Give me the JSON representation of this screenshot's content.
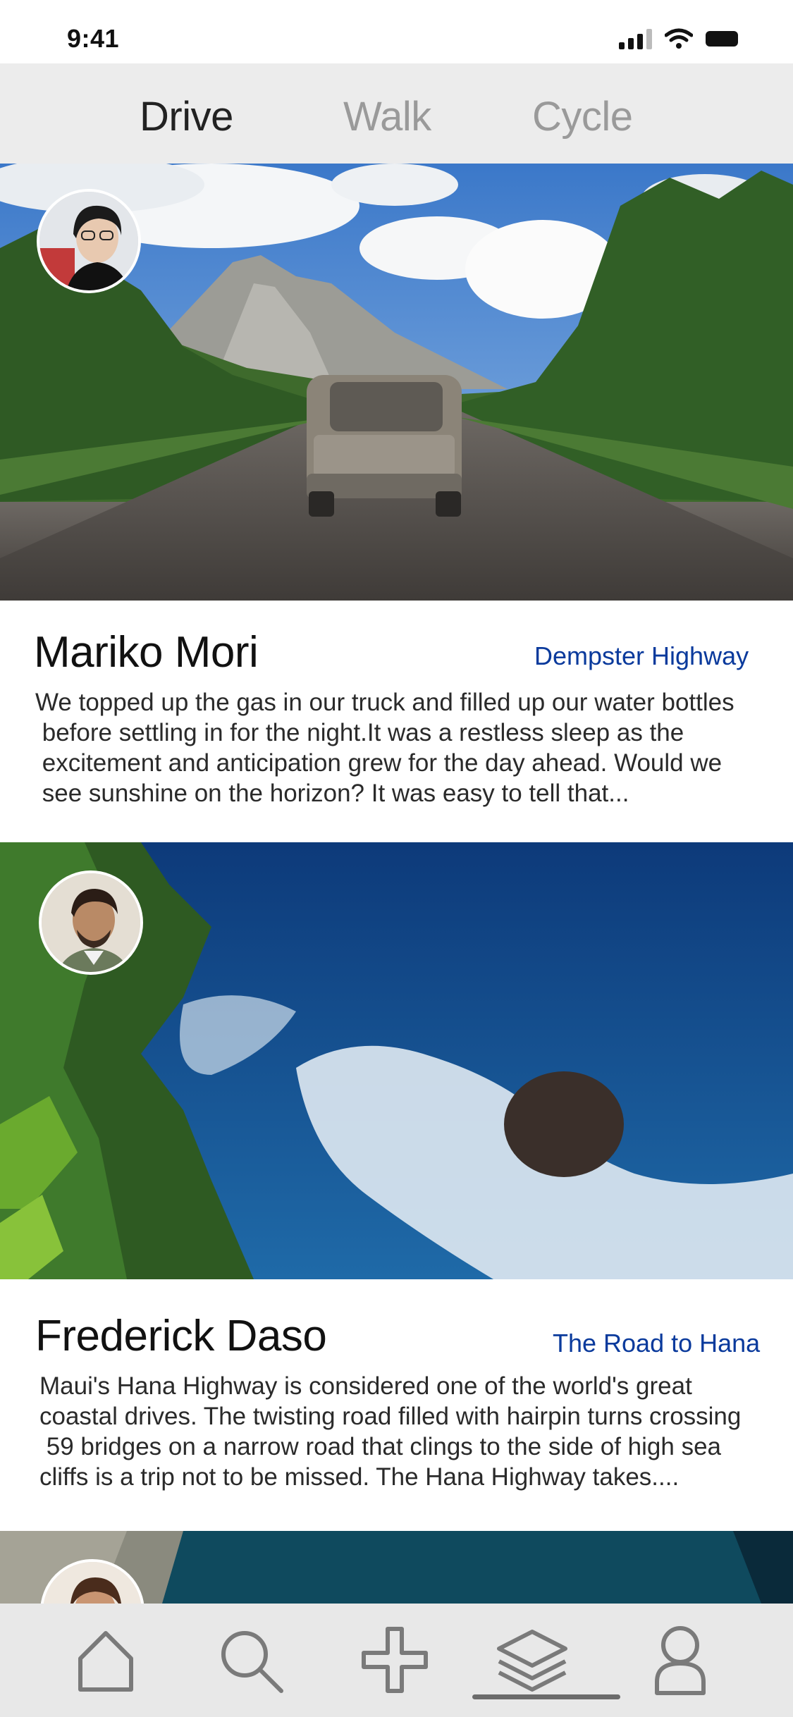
{
  "status_bar": {
    "time": "9:41"
  },
  "tabs": [
    {
      "label": "Drive",
      "active": true
    },
    {
      "label": "Walk",
      "active": false
    },
    {
      "label": "Cycle",
      "active": false
    }
  ],
  "posts": [
    {
      "author": "Mariko Mori",
      "route": "Dempster Highway",
      "excerpt_lines": [
        "We topped up the gas in our truck and filled up our water bottles",
        " before settling in for the night.It was a restless sleep as the",
        " excitement and anticipation grew for the day ahead. Would we",
        " see sunshine on the horizon? It was easy to tell that..."
      ]
    },
    {
      "author": "Frederick Daso",
      "route": "The Road to Hana",
      "excerpt_lines": [
        "Maui's Hana Highway is considered one of the world's great",
        "coastal drives. The twisting road filled with hairpin turns crossing",
        " 59 bridges on a narrow road that clings to the side of high sea",
        "cliffs is a trip not to be missed. The Hana Highway takes...."
      ]
    }
  ],
  "bottom_nav": [
    {
      "icon": "home-icon"
    },
    {
      "icon": "search-icon"
    },
    {
      "icon": "add-icon"
    },
    {
      "icon": "layers-icon",
      "active": true
    },
    {
      "icon": "profile-icon"
    }
  ],
  "colors": {
    "accent_link": "#0a3a9c",
    "tab_bar_bg": "#ececec",
    "nav_bg": "#e8e8e8",
    "tab_inactive": "#9a9a9a"
  }
}
